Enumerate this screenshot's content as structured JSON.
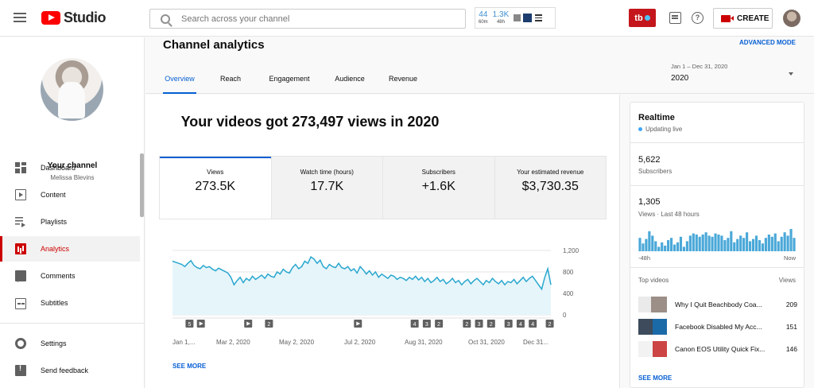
{
  "header": {
    "search_placeholder": "Search across your channel",
    "logo_text": "Studio",
    "extension": {
      "stat1_value": "44",
      "stat1_label": "60m",
      "stat2_value": "1.3K",
      "stat2_label": "48h"
    },
    "tb_badge": "tb",
    "help_glyph": "?",
    "create_label": "CREATE"
  },
  "sidebar": {
    "channel_title": "Your channel",
    "channel_name": "Melissa Blevins",
    "items": [
      {
        "label": "Dashboard",
        "icon": "dashboard-icon"
      },
      {
        "label": "Content",
        "icon": "content-icon"
      },
      {
        "label": "Playlists",
        "icon": "playlists-icon"
      },
      {
        "label": "Analytics",
        "icon": "analytics-icon",
        "active": true
      },
      {
        "label": "Comments",
        "icon": "comments-icon"
      },
      {
        "label": "Subtitles",
        "icon": "subtitles-icon"
      }
    ],
    "bottom_items": [
      {
        "label": "Settings",
        "icon": "gear-icon"
      },
      {
        "label": "Send feedback",
        "icon": "feedback-icon"
      }
    ]
  },
  "main": {
    "title": "Channel analytics",
    "advanced_mode": "ADVANCED MODE",
    "tabs": [
      "Overview",
      "Reach",
      "Engagement",
      "Audience",
      "Revenue"
    ],
    "date_range_sub": "Jan 1 – Dec 31, 2020",
    "date_range_value": "2020",
    "headline": "Your videos got 273,497 views in 2020",
    "metrics": [
      {
        "label": "Views",
        "value": "273.5K"
      },
      {
        "label": "Watch time (hours)",
        "value": "17.7K"
      },
      {
        "label": "Subscribers",
        "value": "+1.6K"
      },
      {
        "label": "Your estimated revenue",
        "value": "$3,730.35"
      }
    ],
    "see_more": "SEE MORE"
  },
  "chart_data": {
    "type": "area",
    "x_tick_labels": [
      "Jan 1,...",
      "Mar 2, 2020",
      "May 2, 2020",
      "Jul 2, 2020",
      "Aug 31, 2020",
      "Oct 31, 2020",
      "Dec 31..."
    ],
    "y_tick_labels": [
      "1,200",
      "800",
      "400",
      "0"
    ],
    "ylim": [
      0,
      1200
    ],
    "values": [
      1000,
      980,
      960,
      940,
      900,
      960,
      1010,
      920,
      880,
      860,
      920,
      880,
      900,
      850,
      820,
      870,
      840,
      810,
      780,
      700,
      560,
      640,
      700,
      600,
      680,
      640,
      720,
      660,
      700,
      740,
      680,
      760,
      720,
      700,
      800,
      760,
      850,
      800,
      780,
      880,
      940,
      860,
      900,
      1000,
      960,
      1080,
      1040,
      960,
      1020,
      900,
      860,
      940,
      900,
      880,
      960,
      880,
      860,
      900,
      820,
      860,
      780,
      900,
      840,
      760,
      820,
      740,
      800,
      700,
      760,
      720,
      680,
      740,
      720,
      660,
      700,
      680,
      640,
      700,
      660,
      720,
      650,
      700,
      620,
      680,
      600,
      640,
      700,
      620,
      660,
      580,
      620,
      680,
      600,
      640,
      560,
      620,
      660,
      580,
      640,
      680,
      620,
      560,
      640,
      600,
      680,
      620,
      580,
      640,
      560,
      620,
      600,
      660,
      580,
      640,
      700,
      620,
      680,
      720,
      640,
      560,
      480,
      700,
      860,
      560
    ],
    "markers": [
      {
        "at": 0.045,
        "label": "5"
      },
      {
        "at": 0.075,
        "label": "play"
      },
      {
        "at": 0.2,
        "label": "play"
      },
      {
        "at": 0.255,
        "label": "2"
      },
      {
        "at": 0.49,
        "label": "play"
      },
      {
        "at": 0.64,
        "label": "4"
      },
      {
        "at": 0.672,
        "label": "3"
      },
      {
        "at": 0.704,
        "label": "2"
      },
      {
        "at": 0.778,
        "label": "2"
      },
      {
        "at": 0.81,
        "label": "3"
      },
      {
        "at": 0.842,
        "label": "2"
      },
      {
        "at": 0.888,
        "label": "3"
      },
      {
        "at": 0.92,
        "label": "4"
      },
      {
        "at": 0.952,
        "label": "4"
      },
      {
        "at": 0.997,
        "label": "2"
      }
    ],
    "colors": {
      "line": "#2aa7cf",
      "fill": "#e6f5fa"
    }
  },
  "realtime": {
    "title": "Realtime",
    "status": "Updating live",
    "subscribers_value": "5,622",
    "subscribers_label": "Subscribers",
    "views_value": "1,305",
    "views_label": "Views · Last 48 hours",
    "axis_start": "-48h",
    "axis_end": "Now",
    "bars": [
      12,
      7,
      11,
      18,
      14,
      9,
      4,
      8,
      5,
      10,
      12,
      6,
      8,
      13,
      4,
      9,
      14,
      16,
      15,
      13,
      15,
      17,
      14,
      13,
      16,
      15,
      14,
      10,
      12,
      18,
      8,
      11,
      14,
      12,
      17,
      9,
      11,
      14,
      10,
      7,
      12,
      15,
      13,
      16,
      9,
      13,
      17,
      14,
      20,
      12
    ],
    "top_videos_label": "Top videos",
    "views_header": "Views",
    "videos": [
      {
        "title": "Why I Quit Beachbody Coa...",
        "views": "209"
      },
      {
        "title": "Facebook Disabled My Acc...",
        "views": "151"
      },
      {
        "title": "Canon EOS Utility Quick Fix...",
        "views": "146"
      }
    ],
    "see_more": "SEE MORE"
  }
}
